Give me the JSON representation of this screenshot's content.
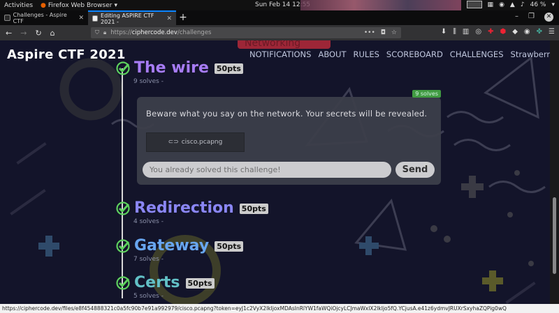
{
  "system": {
    "activities": "Activities",
    "app_menu": "Firefox Web Browser",
    "clock": "Sun Feb 14  12:55",
    "battery": "46 %"
  },
  "browser": {
    "tabs": [
      {
        "title": "Challenges - Aspire CTF"
      },
      {
        "title": "Editing ASPIRE CTF 2021 -"
      }
    ],
    "url_scheme": "https://",
    "url_host": "ciphercode.dev",
    "url_path": "/challenges",
    "status_url": "https://ciphercode.dev/files/e8f454888321c0a5fc90b7e91a992979/cisco.pcapng?token=eyJ1c2VyX2lkIjoxMDAsInRlYW1faWQiOjcyLCJmaWxlX2lkIjo5fQ.YCjusA.e41z6ydmvJRUXrSxyhaZQPig0wQ"
  },
  "site": {
    "title": "Aspire CTF 2021",
    "category_ghost": "Networking",
    "nav": [
      "NOTIFICATIONS",
      "ABOUT",
      "RULES",
      "SCOREBOARD",
      "CHALLENGES"
    ],
    "user": "StrawberryCow"
  },
  "challenges": [
    {
      "name": "The wire",
      "pts": "50pts",
      "solves": "9 solves -",
      "color": "#a77cf5"
    },
    {
      "name": "Redirection",
      "pts": "50pts",
      "solves": "4 solves -",
      "color": "#8a86f5"
    },
    {
      "name": "Gateway",
      "pts": "50pts",
      "solves": "7 solves -",
      "color": "#68a6f0"
    },
    {
      "name": "Certs",
      "pts": "50pts",
      "solves": "5 solves -",
      "color": "#62c0c6"
    }
  ],
  "panel": {
    "badge": "9 solves",
    "description": "Beware what you say on the network. Your secrets will be revealed.",
    "file": "cisco.pcapng",
    "flag_placeholder": "You already solved this challenge!",
    "send_label": "Send"
  },
  "colors": {
    "check": "#5ed15e",
    "accent": "#0a84ff"
  }
}
